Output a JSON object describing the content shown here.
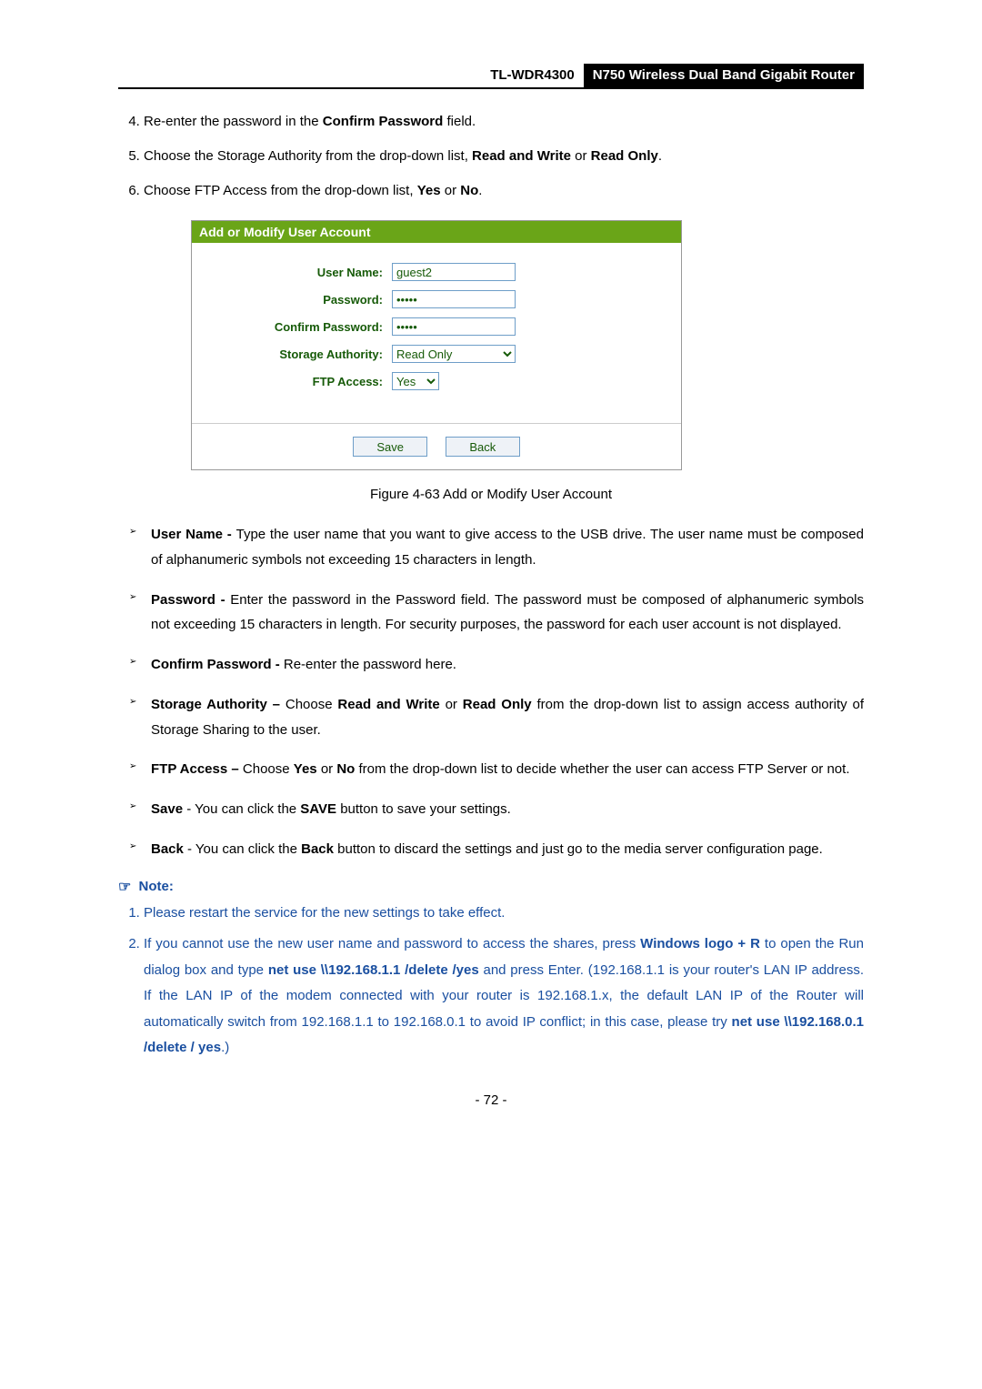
{
  "header": {
    "model": "TL-WDR4300",
    "title": "N750 Wireless Dual Band Gigabit Router"
  },
  "instructions": {
    "start": 4,
    "items": [
      {
        "prefix": "Re-enter the password in the ",
        "bold1": "Confirm Password",
        "suffix": " field."
      },
      {
        "prefix": "Choose the Storage Authority from the drop-down list, ",
        "bold1": "Read and Write",
        "mid": " or ",
        "bold2": "Read Only",
        "suffix": "."
      },
      {
        "prefix": "Choose FTP Access from the drop-down list, ",
        "bold1": "Yes",
        "mid": " or ",
        "bold2": "No",
        "suffix": "."
      }
    ]
  },
  "figure": {
    "panel_title": "Add or Modify User Account",
    "rows": {
      "username_label": "User Name:",
      "username_value": "guest2",
      "password_label": "Password:",
      "password_value": "•••••",
      "confirm_label": "Confirm Password:",
      "confirm_value": "•••••",
      "storage_label": "Storage Authority:",
      "storage_value": "Read Only",
      "ftp_label": "FTP Access:",
      "ftp_value": "Yes"
    },
    "buttons": {
      "save": "Save",
      "back": "Back"
    },
    "caption": "Figure 4-63 Add or Modify User Account"
  },
  "bullets": [
    {
      "b1": "User Name - ",
      "t1": "Type the user name that you want to give access to the USB drive. The user name must be composed of alphanumeric symbols not exceeding 15 characters in length."
    },
    {
      "b1": "Password - ",
      "t1": "Enter the password in the Password field. The password must be composed of alphanumeric symbols not exceeding 15 characters in length. For security purposes, the password for each user account is not displayed."
    },
    {
      "b1": "Confirm Password - ",
      "t1": "Re-enter the password here."
    },
    {
      "b1": "Storage Authority – ",
      "t1": "Choose ",
      "b2": "Read and Write",
      "t2": " or ",
      "b3": "Read Only",
      "t3": " from the drop-down list to assign access authority of Storage Sharing to the user."
    },
    {
      "b1": "FTP Access – ",
      "t1": "Choose ",
      "b2": "Yes",
      "t2": " or ",
      "b3": "No",
      "t3": " from the drop-down list to decide whether the user can access FTP Server or not."
    },
    {
      "b1": "Save",
      "t1": " - You can click the ",
      "b2": "SAVE",
      "t2": " button to save your settings."
    },
    {
      "b1": "Back",
      "t1": " - You can click the ",
      "b2": "Back",
      "t2": " button to discard the settings and just go to the media server configuration page."
    }
  ],
  "note": {
    "heading": "Note:",
    "items": [
      {
        "t1": "Please restart the service for the new settings to take effect."
      },
      {
        "t1": "If you cannot use the new user name and password to access the shares, press ",
        "b1": "Windows logo + R",
        "t2": " to open the Run dialog box and type ",
        "b2": "net use \\\\192.168.1.1 /delete /yes",
        "t3": " and press Enter. (192.168.1.1 is your router's LAN IP address. If the LAN IP of the modem connected with your router is 192.168.1.x, the default LAN IP of the Router will automatically switch from 192.168.1.1 to 192.168.0.1 to avoid IP conflict; in this case, please try ",
        "b3": "net use \\\\192.168.0.1 /delete / yes",
        "t4": ".)"
      }
    ]
  },
  "page_number": "- 72 -"
}
